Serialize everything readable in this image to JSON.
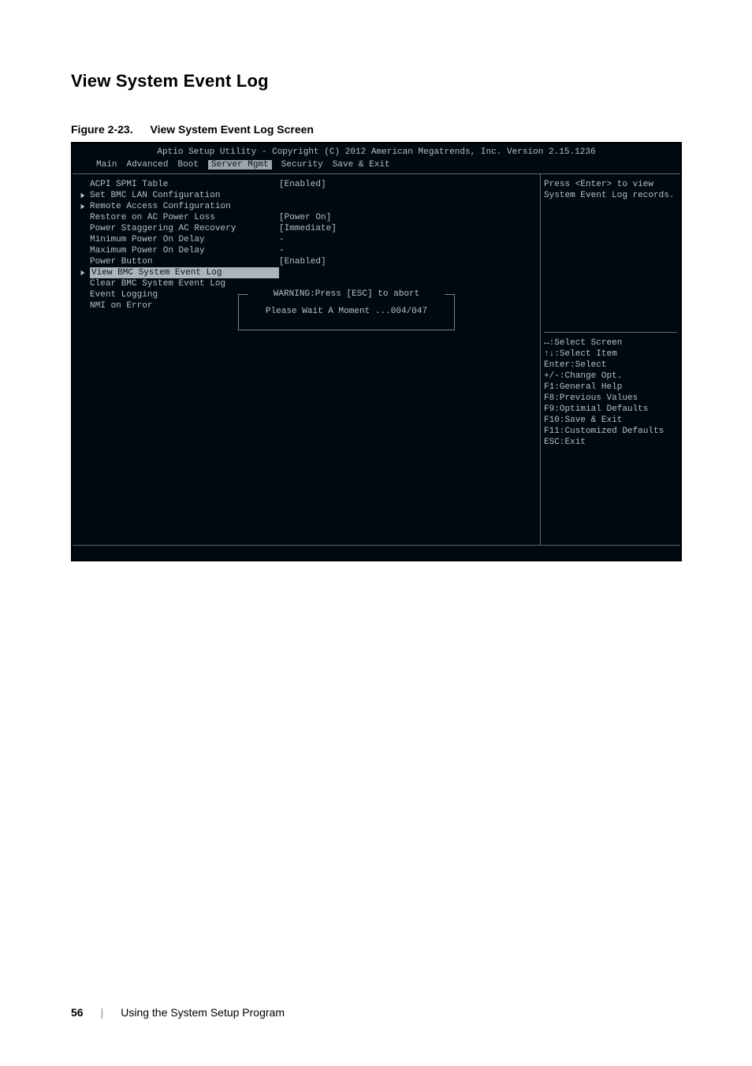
{
  "doc": {
    "heading": "View System Event Log",
    "fig_num": "Figure 2-23.",
    "fig_title": "View System Event Log Screen",
    "page_number": "56",
    "divider": "|",
    "chapter_title": "Using the System Setup Program"
  },
  "bios": {
    "title": "Aptio Setup Utility - Copyright (C) 2012 American Megatrends, Inc.  Version 2.15.1236",
    "menu": {
      "items": [
        "Main",
        "Advanced",
        "Boot",
        "Server Mgmt",
        "Security",
        "Save & Exit"
      ],
      "selected_index": 3
    },
    "rows": [
      {
        "caret": false,
        "label": "ACPI SPMI Table",
        "value": "[Enabled]",
        "hl": false
      },
      {
        "caret": true,
        "label": "Set BMC LAN Configuration",
        "value": "",
        "hl": false
      },
      {
        "caret": true,
        "label": "Remote Access Configuration",
        "value": "",
        "hl": false
      },
      {
        "caret": false,
        "label": "Restore on AC Power Loss",
        "value": "[Power On]",
        "hl": false
      },
      {
        "caret": false,
        "label": "Power Staggering AC Recovery",
        "value": "[Immediate]",
        "hl": false
      },
      {
        "caret": false,
        "label": "Minimum Power On Delay",
        "value": "-",
        "hl": false
      },
      {
        "caret": false,
        "label": "Maximum Power On Delay",
        "value": "-",
        "hl": false
      },
      {
        "caret": false,
        "label": "Power Button",
        "value": "[Enabled]",
        "hl": false
      },
      {
        "caret": true,
        "label": "View BMC System Event Log",
        "value": "",
        "hl": true
      },
      {
        "caret": false,
        "label": "Clear BMC System Event Log",
        "value": "",
        "hl": false
      },
      {
        "caret": false,
        "label": "Event Logging",
        "value": "",
        "hl": false
      },
      {
        "caret": false,
        "label": "NMI on Error",
        "value": "",
        "hl": false
      }
    ],
    "popup": {
      "title": "WARNING:Press [ESC] to abort",
      "body": "Please Wait A Moment ...004/047"
    },
    "help": {
      "contextual": "Press <Enter> to view System Event Log records.",
      "bindings": [
        "↔:Select Screen",
        "↑↓:Select Item",
        "Enter:Select",
        "+/-:Change Opt.",
        "F1:General Help",
        "F8:Previous Values",
        "F9:Optimial Defaults",
        "F10:Save & Exit",
        "F11:Customized Defaults",
        "ESC:Exit"
      ]
    }
  }
}
